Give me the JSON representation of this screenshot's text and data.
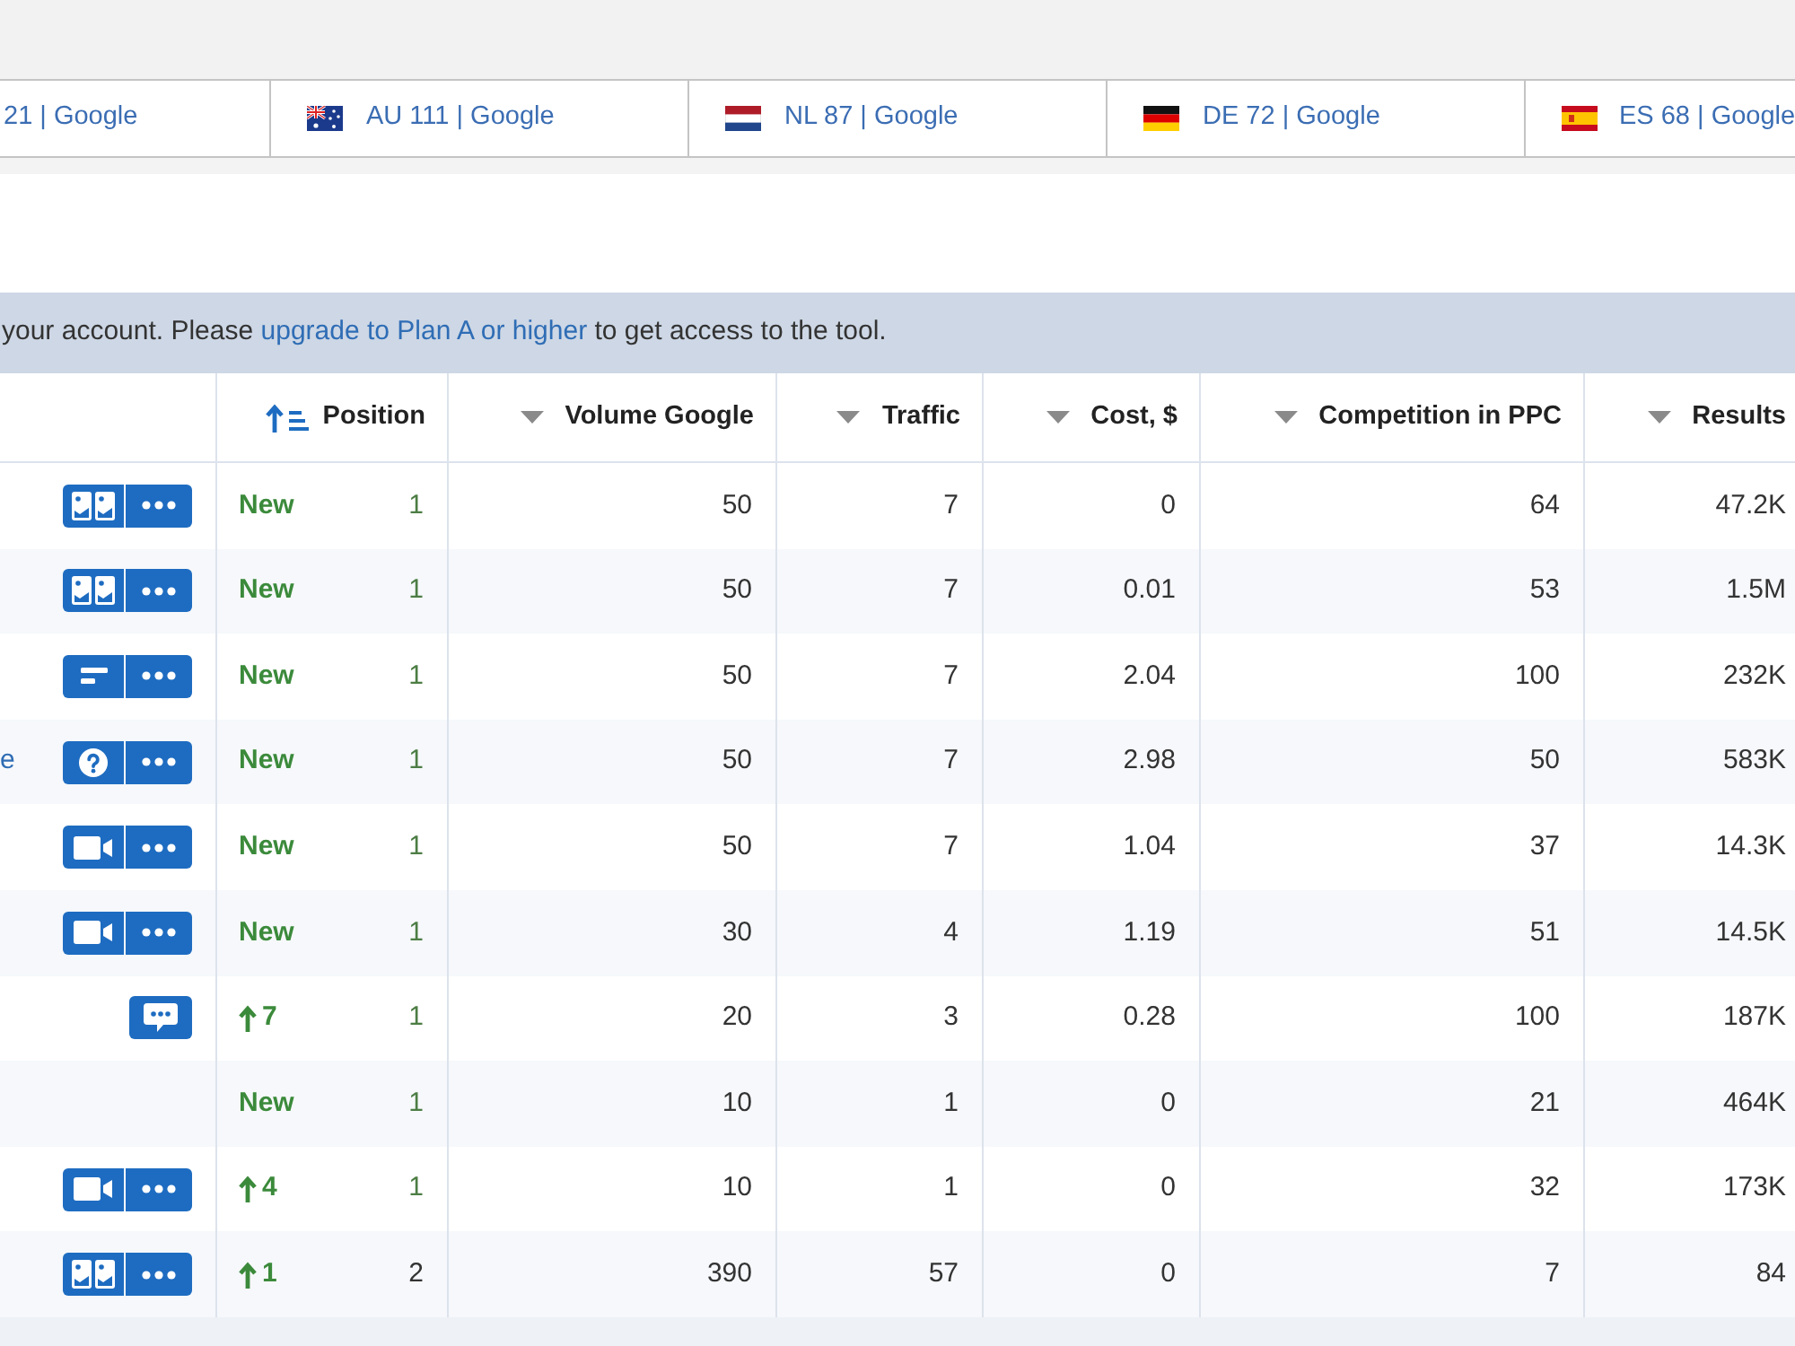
{
  "tabs": [
    {
      "label": "21 | Google"
    },
    {
      "label": "AU 111 | Google",
      "kind": "au"
    },
    {
      "label": "NL 87 | Google",
      "kind": "nl"
    },
    {
      "label": "DE 72 | Google",
      "kind": "de"
    },
    {
      "label": "ES 68 | Google",
      "kind": "es"
    }
  ],
  "notice": {
    "before": "your account. Please ",
    "link": "upgrade to Plan A or higher",
    "after": " to get access to the tool."
  },
  "table": {
    "columns": [
      {
        "label": "Position",
        "sorted": true
      },
      {
        "label": "Volume Google",
        "sorted": false
      },
      {
        "label": "Traffic",
        "sorted": false
      },
      {
        "label": "Cost, $",
        "sorted": false
      },
      {
        "label": "Competition in PPC",
        "sorted": false
      },
      {
        "label": "Results",
        "sorted": false
      }
    ],
    "rows": [
      {
        "features": [
          {
            "kind": "images"
          },
          {
            "kind": "more"
          }
        ],
        "change": {
          "kind": "new",
          "text": "New"
        },
        "top": true,
        "cells": [
          "1",
          "50",
          "7",
          "0",
          "64",
          "47.2K"
        ]
      },
      {
        "features": [
          {
            "kind": "images"
          },
          {
            "kind": "more"
          }
        ],
        "change": {
          "kind": "new",
          "text": "New"
        },
        "top": true,
        "cells": [
          "1",
          "50",
          "7",
          "0.01",
          "53",
          "1.5M"
        ]
      },
      {
        "features": [
          {
            "kind": "text"
          },
          {
            "kind": "more"
          }
        ],
        "change": {
          "kind": "new",
          "text": "New"
        },
        "top": true,
        "cells": [
          "1",
          "50",
          "7",
          "2.04",
          "100",
          "232K"
        ]
      },
      {
        "keyword": "e",
        "features": [
          {
            "kind": "question"
          },
          {
            "kind": "more"
          }
        ],
        "change": {
          "kind": "new",
          "text": "New"
        },
        "top": true,
        "cells": [
          "1",
          "50",
          "7",
          "2.98",
          "50",
          "583K"
        ]
      },
      {
        "features": [
          {
            "kind": "video"
          },
          {
            "kind": "more"
          }
        ],
        "change": {
          "kind": "new",
          "text": "New"
        },
        "top": true,
        "cells": [
          "1",
          "50",
          "7",
          "1.04",
          "37",
          "14.3K"
        ]
      },
      {
        "features": [
          {
            "kind": "video"
          },
          {
            "kind": "more"
          }
        ],
        "change": {
          "kind": "new",
          "text": "New"
        },
        "top": true,
        "cells": [
          "1",
          "30",
          "4",
          "1.19",
          "51",
          "14.5K"
        ]
      },
      {
        "features": [
          {
            "kind": "chat"
          }
        ],
        "change": {
          "kind": "up",
          "text": "7"
        },
        "top": true,
        "cells": [
          "1",
          "20",
          "3",
          "0.28",
          "100",
          "187K"
        ]
      },
      {
        "change": {
          "kind": "new",
          "text": "New"
        },
        "top": true,
        "cells": [
          "1",
          "10",
          "1",
          "0",
          "21",
          "464K"
        ]
      },
      {
        "features": [
          {
            "kind": "video"
          },
          {
            "kind": "more"
          }
        ],
        "change": {
          "kind": "up",
          "text": "4"
        },
        "top": true,
        "cells": [
          "1",
          "10",
          "1",
          "0",
          "32",
          "173K"
        ]
      },
      {
        "features": [
          {
            "kind": "images"
          },
          {
            "kind": "more"
          }
        ],
        "change": {
          "kind": "up",
          "text": "1"
        },
        "top": false,
        "cells": [
          "2",
          "390",
          "57",
          "0",
          "7",
          "84"
        ]
      }
    ]
  }
}
